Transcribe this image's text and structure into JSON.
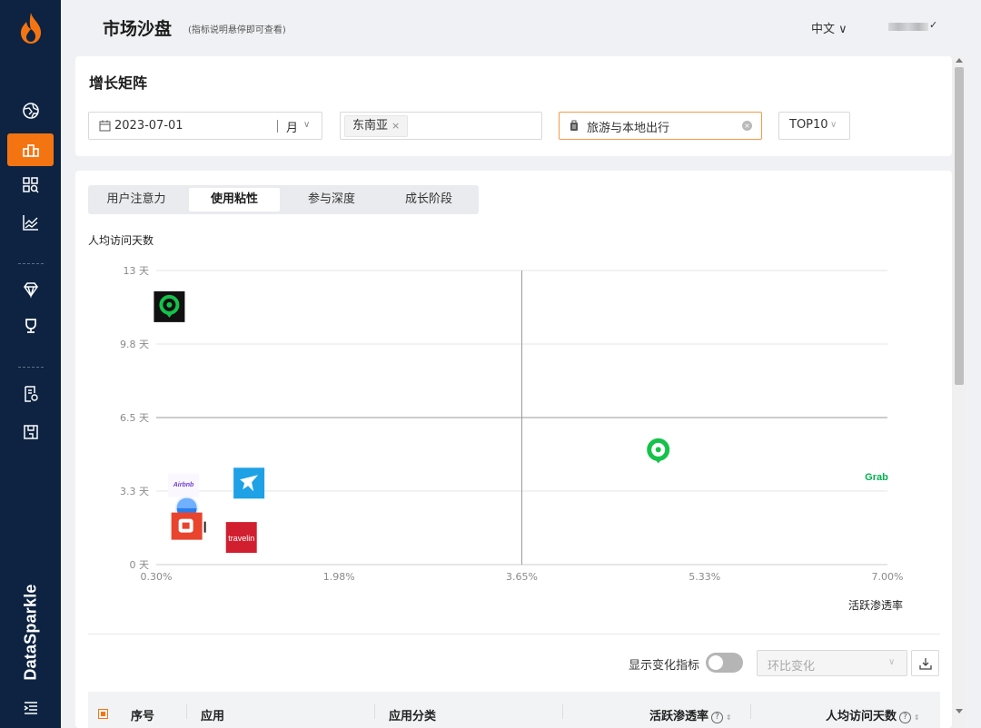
{
  "brand": {
    "name": "DataSparkle"
  },
  "header": {
    "title": "市场沙盘",
    "hint": "(指标说明悬停即可查看)",
    "language": "中文 ∨"
  },
  "filters": {
    "title": "增长矩阵",
    "date": "2023-07-01",
    "period": "月",
    "region_tag": "东南亚",
    "category": "旅游与本地出行",
    "top": "TOP10"
  },
  "tabs": [
    {
      "label": "用户注意力",
      "active": false
    },
    {
      "label": "使用粘性",
      "active": true
    },
    {
      "label": "参与深度",
      "active": false
    },
    {
      "label": "成长阶段",
      "active": false
    }
  ],
  "chart_data": {
    "type": "scatter",
    "ylabel": "人均访问天数",
    "xlabel": "活跃渗透率",
    "x_ticks": [
      "0.30%",
      "1.98%",
      "3.65%",
      "5.33%",
      "7.00%"
    ],
    "y_ticks": [
      "0 天",
      "3.3 天",
      "6.5 天",
      "9.8 天",
      "13 天"
    ],
    "xlim": [
      0.3,
      7.0
    ],
    "ylim": [
      0,
      13
    ],
    "x_midline": 3.65,
    "y_midline": 6.5,
    "points": [
      {
        "x": 0.42,
        "y": 11.4,
        "icon": "green-ring-app-icon",
        "color": "#15c24a"
      },
      {
        "x": 4.9,
        "y": 5.0,
        "icon": "green-ring-app-icon",
        "color": "#15c24a"
      },
      {
        "x": 6.9,
        "y": 3.9,
        "icon": "grab-app-icon",
        "color": "#00b14f"
      },
      {
        "x": 0.55,
        "y": 3.5,
        "icon": "purple-logo-app-icon",
        "color": "#6b3fd1"
      },
      {
        "x": 1.15,
        "y": 3.6,
        "icon": "blue-bird-app-icon",
        "color": "#1fa1e6"
      },
      {
        "x": 0.58,
        "y": 2.5,
        "icon": "blue-drop-app-icon",
        "color": "#2b7de9"
      },
      {
        "x": 0.58,
        "y": 1.7,
        "icon": "red-orange-app-icon",
        "color": "#e8442e"
      },
      {
        "x": 1.08,
        "y": 1.2,
        "icon": "traveloka-app-icon",
        "color": "#d21f2f"
      }
    ],
    "labels": {
      "grab": "Grab",
      "traveloka": "travelin",
      "purple": "Airbnb"
    }
  },
  "controls": {
    "toggle_label": "显示变化指标",
    "compare_select": "环比变化"
  },
  "table": {
    "headers": [
      "序号",
      "应用",
      "应用分类",
      "活跃渗透率",
      "人均访问天数"
    ]
  }
}
